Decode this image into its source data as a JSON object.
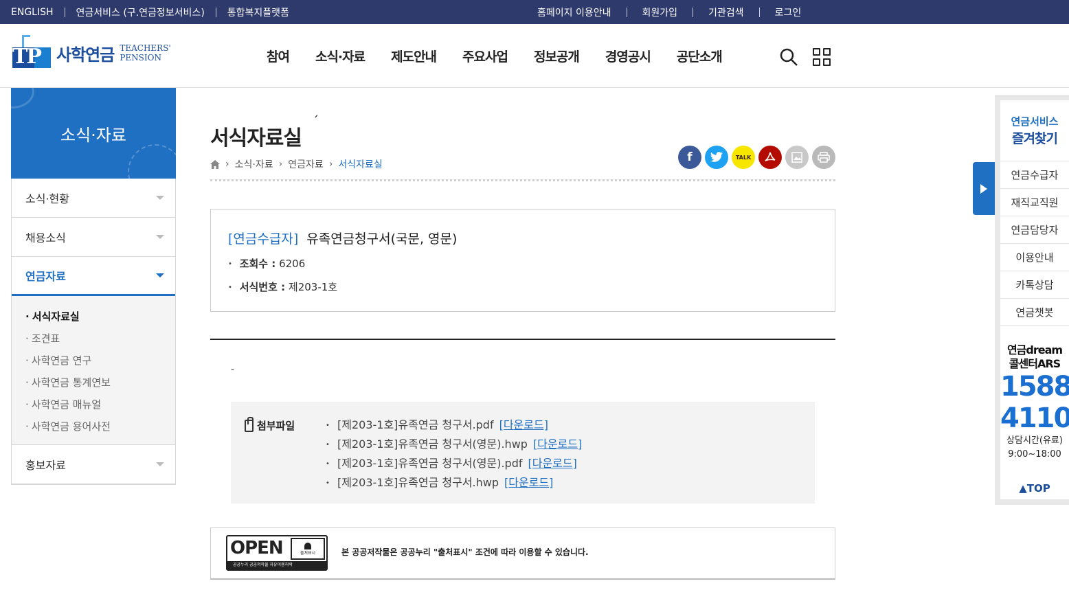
{
  "utilbar": {
    "left": [
      "ENGLISH",
      "연금서비스 (구.연금정보서비스)",
      "통합복지플랫폼"
    ],
    "right": [
      "홈페이지 이용안내",
      "회원가입",
      "기관검색",
      "로그인"
    ]
  },
  "logo": {
    "kr": "사학연금",
    "en_line1": "TEACHERS'",
    "en_line2": "PENSION",
    "mark": "TP"
  },
  "gnb": [
    "참여",
    "소식·자료",
    "제도안내",
    "주요사업",
    "정보공개",
    "경영공시",
    "공단소개"
  ],
  "lnb": {
    "title": "소식·자료",
    "items": [
      "소식·현황",
      "채용소식",
      "연금자료",
      "홍보자료"
    ],
    "active_index": 2,
    "sub": [
      "서식자료실",
      "조견표",
      "사학연금 연구",
      "사학연금 통계연보",
      "사학연금 매뉴얼",
      "사학연금 용어사전"
    ],
    "current_sub": 0
  },
  "page": {
    "title": "서식자료실",
    "breadcrumb": [
      "소식·자료",
      "연금자료",
      "서식자료실"
    ]
  },
  "share": [
    {
      "icon": "facebook-icon",
      "glyph": "f",
      "color": "#3b5998"
    },
    {
      "icon": "twitter-icon",
      "glyph": "t",
      "color": "#1da1f2"
    },
    {
      "icon": "kakaotalk-icon",
      "glyph": "TALK",
      "color": "#f7e600"
    },
    {
      "icon": "pdf-icon",
      "glyph": "A",
      "color": "#b30b00"
    },
    {
      "icon": "image-icon",
      "glyph": "▣",
      "color": "#c8c8c8"
    },
    {
      "icon": "print-icon",
      "glyph": "⎙",
      "color": "#b9b9b9"
    }
  ],
  "post": {
    "category": "[연금수급자]",
    "title": "유족연금청구서(국문, 영문)",
    "views_label": "조회수 :",
    "views": "6206",
    "form_no_label": "서식번호 :",
    "form_no": "제203-1호",
    "body": "-"
  },
  "attachments": {
    "label": "첨부파일",
    "download_label": "[다운로드]",
    "files": [
      "[제203-1호]유족연금 청구서.pdf",
      "[제203-1호]유족연금 청구서(영문).hwp",
      "[제203-1호]유족연금 청구서(영문).pdf",
      "[제203-1호]유족연금 청구서.hwp"
    ]
  },
  "license": {
    "open": "OPEN",
    "badge": "출처표시",
    "strip": "공공누리  공공저작물 자유이용허락",
    "text": "본 공공저작물은 공공누리 \"출처표시\" 조건에 따라 이용할 수 있습니다."
  },
  "quick": {
    "title1": "연금서비스",
    "title2": "즐겨찾기",
    "items": [
      "연금수급자",
      "재직교직원",
      "연금담당자",
      "이용안내",
      "카톡상담",
      "연금챗봇"
    ],
    "call_line1": "연금dream",
    "call_line2": "콜센터ARS",
    "num1": "1588",
    "num2": "4110",
    "hours_label": "상담시간(유료)",
    "hours": "9:00~18:00",
    "top": "▲TOP"
  }
}
